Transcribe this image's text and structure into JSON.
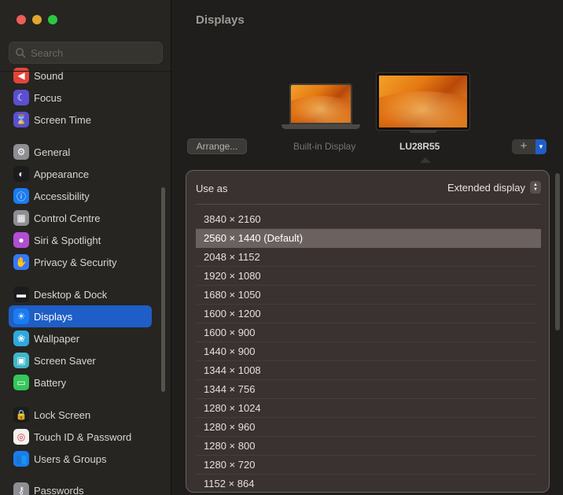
{
  "window": {
    "traffic_lights": [
      "close",
      "minimize",
      "zoom"
    ]
  },
  "search": {
    "placeholder": "Search"
  },
  "sidebar": {
    "items": [
      {
        "label": "Sound",
        "icon": "sound-icon",
        "color": "#e2443a"
      },
      {
        "label": "Focus",
        "icon": "moon-icon",
        "color": "#5b4fd0"
      },
      {
        "label": "Screen Time",
        "icon": "hourglass-icon",
        "color": "#5b4fd0"
      },
      {
        "label": "General",
        "icon": "gear-icon",
        "color": "#8e8e93"
      },
      {
        "label": "Appearance",
        "icon": "appearance-icon",
        "color": "#1c1c1e"
      },
      {
        "label": "Accessibility",
        "icon": "accessibility-icon",
        "color": "#1a7cf0"
      },
      {
        "label": "Control Centre",
        "icon": "control-centre-icon",
        "color": "#8e8e93"
      },
      {
        "label": "Siri & Spotlight",
        "icon": "siri-icon",
        "color": "#b14ed2"
      },
      {
        "label": "Privacy & Security",
        "icon": "hand-icon",
        "color": "#3478f6"
      },
      {
        "label": "Desktop & Dock",
        "icon": "dock-icon",
        "color": "#1c1c1e"
      },
      {
        "label": "Displays",
        "icon": "sun-icon",
        "color": "#1a7cf0"
      },
      {
        "label": "Wallpaper",
        "icon": "wallpaper-icon",
        "color": "#30a8dd"
      },
      {
        "label": "Screen Saver",
        "icon": "screensaver-icon",
        "color": "#40b6c9"
      },
      {
        "label": "Battery",
        "icon": "battery-icon",
        "color": "#34c759"
      },
      {
        "label": "Lock Screen",
        "icon": "lock-icon",
        "color": "#1c1c1e"
      },
      {
        "label": "Touch ID & Password",
        "icon": "fingerprint-icon",
        "color": "#f2f2f2"
      },
      {
        "label": "Users & Groups",
        "icon": "users-icon",
        "color": "#1a7cf0"
      },
      {
        "label": "Passwords",
        "icon": "key-icon",
        "color": "#8e8e93"
      }
    ],
    "active": "Displays"
  },
  "main": {
    "title": "Displays",
    "arrange_label": "Arrange...",
    "builtin_label": "Built-in Display",
    "selected_label": "LU28R55",
    "add_label": "+"
  },
  "popup": {
    "use_as_label": "Use as",
    "use_as_value": "Extended display",
    "resolutions": [
      "3840 × 2160",
      "2560 × 1440 (Default)",
      "2048 × 1152",
      "1920 × 1080",
      "1680 × 1050",
      "1600 × 1200",
      "1600 × 900",
      "1440 × 900",
      "1344 × 1008",
      "1344 × 756",
      "1280 × 1024",
      "1280 × 960",
      "1280 × 800",
      "1280 × 720",
      "1152 × 864"
    ],
    "selected_resolution": "2560 × 1440 (Default)"
  },
  "colors": {
    "accent": "#1f5ec7",
    "popup_bg": "#3a3230"
  }
}
